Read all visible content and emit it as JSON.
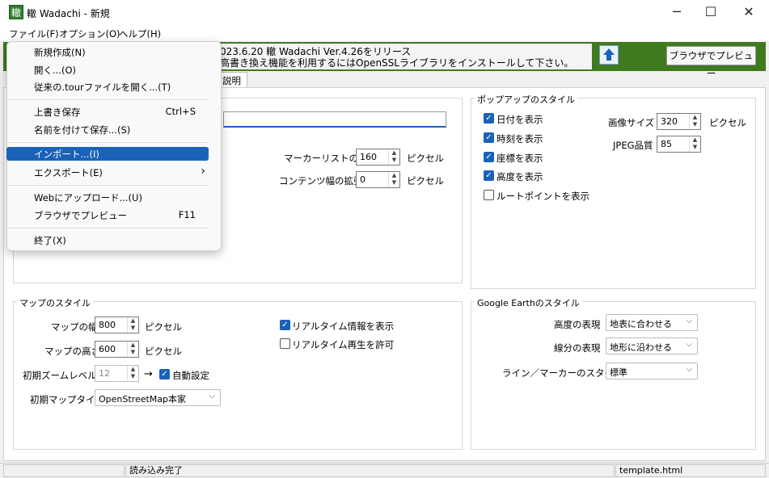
{
  "window": {
    "app_icon_text": "轍",
    "title": "轍 Wadachi - 新規",
    "minimize": "─",
    "maximize": "☐",
    "close": "✕"
  },
  "menubar": [
    "ファイル(F)",
    "オプション(O)",
    "ヘルプ(H)"
  ],
  "banner": {
    "line1": "023.6.20 轍 Wadachi Ver.4.26をリリース",
    "line2": "高書き換え機能を利用するにはOpenSSLライブラリをインストールして下さい。",
    "preview_button": "ブラウザでプレビュー"
  },
  "tab_label": "説明",
  "file_menu": {
    "new": "新規作成(N)",
    "open": "開く...(O)",
    "open_tour": "従来の.tourファイルを開く...(T)",
    "save": "上書き保存",
    "save_shortcut": "Ctrl+S",
    "save_as": "名前を付けて保存...(S)",
    "import": "インポート...(I)",
    "export": "エクスポート(E)",
    "export_arrow": "›",
    "upload": "Webにアップロード...(U)",
    "preview": "ブラウザでプレビュー",
    "preview_shortcut": "F11",
    "exit": "終了(X)"
  },
  "content_settings": {
    "marker_list_width_label": "マーカーリストの幅",
    "marker_list_width": "160",
    "contents_width_label": "コンテンツ幅の拡張",
    "contents_width": "0",
    "unit": "ピクセル"
  },
  "popup_style": {
    "title": "ポップアップのスタイル",
    "show_date": "日付を表示",
    "show_time": "時刻を表示",
    "show_coords": "座標を表示",
    "show_altitude": "高度を表示",
    "show_route": "ルートポイントを表示",
    "image_size_label": "画像サイズ",
    "image_size": "320",
    "unit": "ピクセル",
    "jpeg_quality_label": "JPEG品質",
    "jpeg_quality": "85"
  },
  "map_style": {
    "title": "マップのスタイル",
    "width_label": "マップの幅",
    "width": "800",
    "height_label": "マップの高さ",
    "height": "600",
    "unit": "ピクセル",
    "zoom_label": "初期ズームレベル",
    "zoom": "12",
    "arrow": "→",
    "auto": "自動設定",
    "type_label": "初期マップタイプ",
    "type": "OpenStreetMap本家",
    "realtime_info": "リアルタイム情報を表示",
    "realtime_play": "リアルタイム再生を許可"
  },
  "google_earth": {
    "title": "Google Earthのスタイル",
    "altitude_label": "高度の表現",
    "altitude": "地表に合わせる",
    "line_label": "線分の表現",
    "line": "地形に沿わせる",
    "style_label": "ライン／マーカーのスタイル",
    "style": "標準"
  },
  "status": {
    "message": "読み込み完了",
    "template": "template.html"
  }
}
